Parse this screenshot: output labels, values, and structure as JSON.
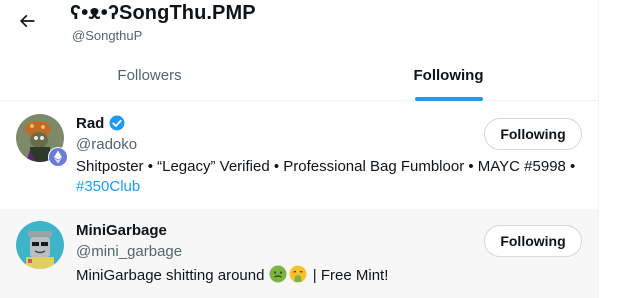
{
  "header": {
    "title": "ʕ•ᴥ•ʔSongThu.PMP",
    "handle": "@SongthuP"
  },
  "tabs": [
    {
      "label": "Followers",
      "active": false
    },
    {
      "label": "Following",
      "active": true
    }
  ],
  "users": [
    {
      "name": "Rad",
      "verified": true,
      "handle": "@radoko",
      "bio_text": "Shitposter • “Legacy” Verified • Professional Bag Fumbloor • MAYC #5998 • ",
      "bio_link": "#350Club",
      "button_label": "Following"
    },
    {
      "name": "MiniGarbage",
      "verified": false,
      "handle": "@mini_garbage",
      "bio_text": "MiniGarbage shitting around",
      "bio_suffix": " | Free Mint!",
      "bio_emojis": [
        "nauseated-face",
        "face-vomiting"
      ],
      "button_label": "Following"
    }
  ],
  "colors": {
    "accent": "#1d9bf0",
    "text": "#0f1419",
    "secondary_text": "#536471",
    "hover_row": "#f7f7f7"
  }
}
